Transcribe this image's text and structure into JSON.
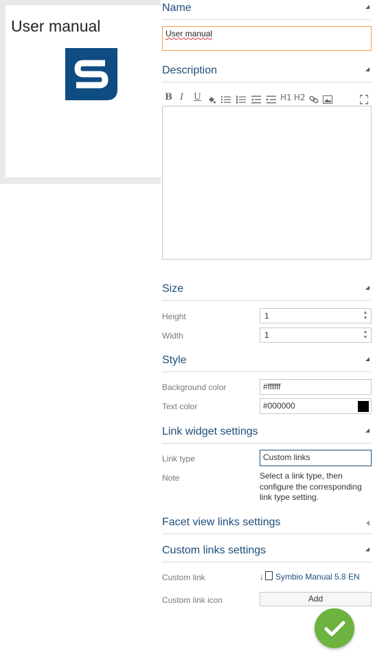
{
  "preview": {
    "title": "User manual",
    "logo_icon": "symbio-s-logo-icon",
    "logo_color": "#0f4c81"
  },
  "name_section": {
    "title": "Name",
    "value": "User manual"
  },
  "description_section": {
    "title": "Description",
    "toolbar": {
      "bold": "B",
      "italic": "I",
      "underline": "U",
      "h1": "H1",
      "h2": "H2"
    }
  },
  "size_section": {
    "title": "Size",
    "height_label": "Height",
    "height_value": "1",
    "width_label": "Width",
    "width_value": "1"
  },
  "style_section": {
    "title": "Style",
    "bg_label": "Background color",
    "bg_value": "#ffffff",
    "text_label": "Text color",
    "text_value": "#000000"
  },
  "link_widget_section": {
    "title": "Link widget settings",
    "link_type_label": "Link type",
    "link_type_value": "Custom links",
    "note_label": "Note",
    "note_text": "Select a link type, then configure the corresponding link type setting."
  },
  "facet_section": {
    "title": "Facet view links settings"
  },
  "custom_links_section": {
    "title": "Custom links settings",
    "custom_link_label": "Custom link",
    "custom_link_prefix": "↓",
    "custom_link_value": "Symbio Manual 5.8 EN",
    "custom_link_icon_label": "Custom link icon",
    "add_label": "Add"
  },
  "accent_color": "#1e4d7a",
  "confirm_color": "#6db33f"
}
